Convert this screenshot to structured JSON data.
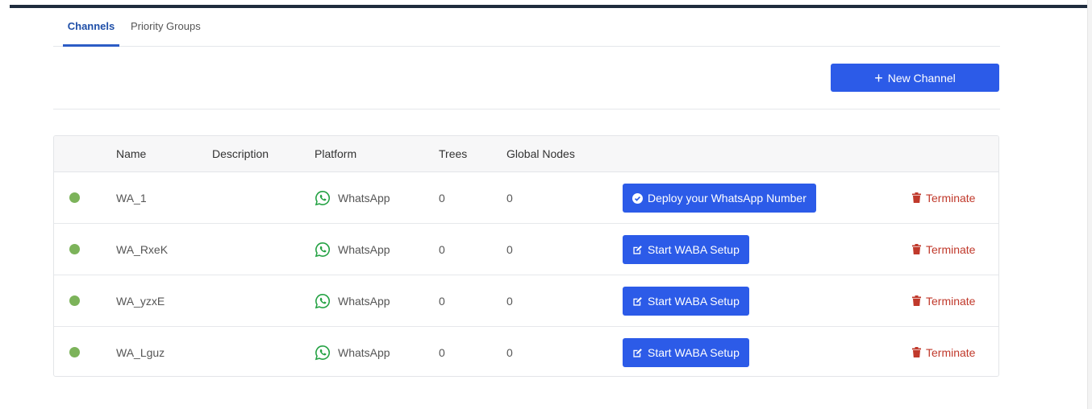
{
  "tabs": [
    {
      "label": "Channels",
      "active": true
    },
    {
      "label": "Priority Groups",
      "active": false
    }
  ],
  "toolbar": {
    "new_channel_label": "New Channel"
  },
  "table": {
    "headers": [
      "Name",
      "Description",
      "Platform",
      "Trees",
      "Global Nodes"
    ],
    "rows": [
      {
        "name": "WA_1",
        "description": "",
        "platform": "WhatsApp",
        "trees": "0",
        "global_nodes": "0",
        "action_label": "Deploy your WhatsApp Number",
        "action_icon": "check-circle-icon",
        "terminate_label": "Terminate",
        "status": "active"
      },
      {
        "name": "WA_RxeK",
        "description": "",
        "platform": "WhatsApp",
        "trees": "0",
        "global_nodes": "0",
        "action_label": "Start WABA Setup",
        "action_icon": "edit-icon",
        "terminate_label": "Terminate",
        "status": "active"
      },
      {
        "name": "WA_yzxE",
        "description": "",
        "platform": "WhatsApp",
        "trees": "0",
        "global_nodes": "0",
        "action_label": "Start WABA Setup",
        "action_icon": "edit-icon",
        "terminate_label": "Terminate",
        "status": "active"
      },
      {
        "name": "WA_Lguz",
        "description": "",
        "platform": "WhatsApp",
        "trees": "0",
        "global_nodes": "0",
        "action_label": "Start WABA Setup",
        "action_icon": "edit-icon",
        "terminate_label": "Terminate",
        "status": "active"
      }
    ]
  },
  "colors": {
    "primary": "#2c5be8",
    "status_active": "#7cb35a",
    "danger": "#c0392b",
    "whatsapp": "#25a244",
    "tab_active": "#1f4fa8"
  }
}
